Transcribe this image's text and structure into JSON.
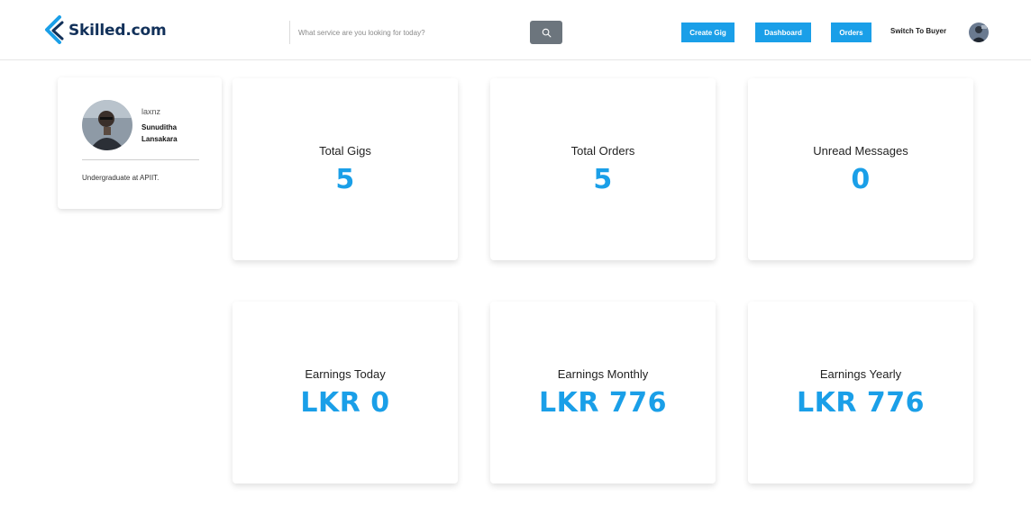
{
  "header": {
    "logo_text": "Skilled.com",
    "search_placeholder": "What service are you looking for today?",
    "buttons": {
      "create_gig": "Create Gig",
      "dashboard": "Dashboard",
      "orders": "Orders"
    },
    "switch_label": "Switch To Buyer"
  },
  "profile": {
    "username": "laxnz",
    "full_name": "Sunuditha Lansakara",
    "bio": "Undergraduate at APIIT."
  },
  "stats": {
    "total_gigs": {
      "label": "Total Gigs",
      "value": "5"
    },
    "total_orders": {
      "label": "Total Orders",
      "value": "5"
    },
    "unread_messages": {
      "label": "Unread Messages",
      "value": "0"
    },
    "earnings_today": {
      "label": "Earnings Today",
      "value": "LKR 0"
    },
    "earnings_monthly": {
      "label": "Earnings Monthly",
      "value": "LKR 776"
    },
    "earnings_yearly": {
      "label": "Earnings Yearly",
      "value": "LKR 776"
    }
  },
  "colors": {
    "accent": "#1a9fe8",
    "logo_dark": "#12315a",
    "search_button": "#6c757d"
  },
  "icons": {
    "logo": "skilled-logo-icon",
    "search": "search-icon"
  }
}
